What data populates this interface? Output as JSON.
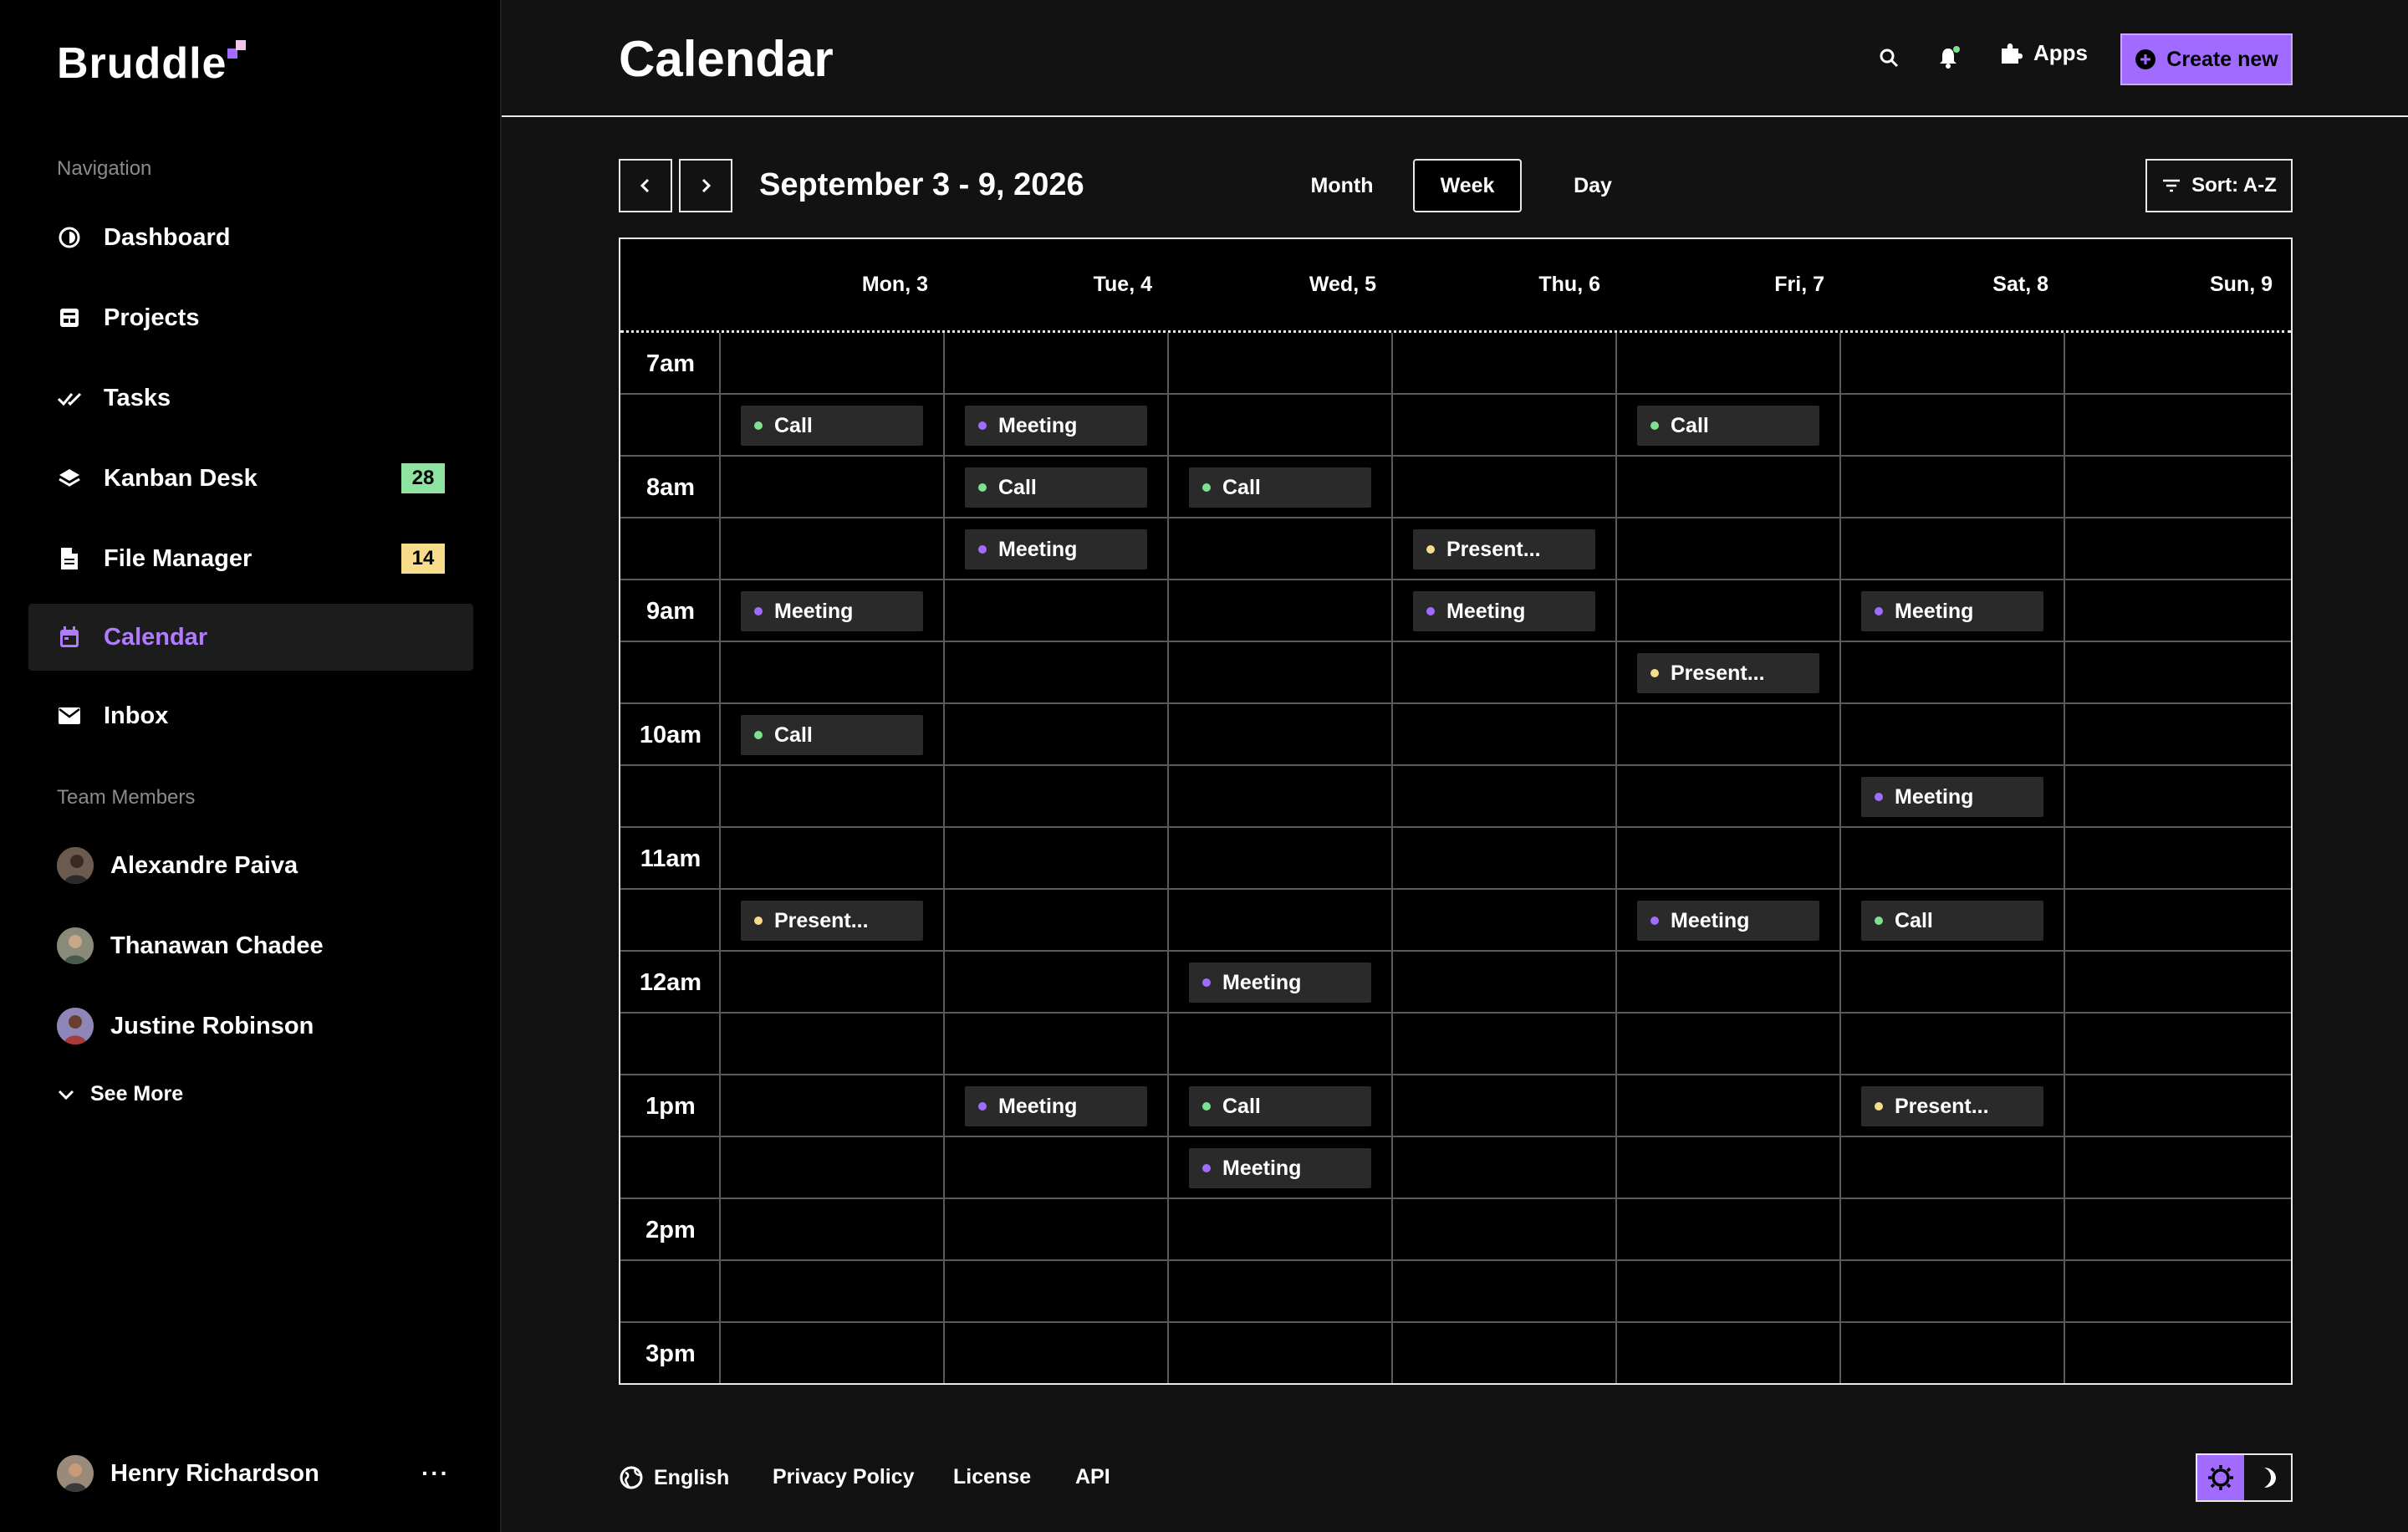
{
  "brand": {
    "name": "Bruddle"
  },
  "sidebar": {
    "nav_label": "Navigation",
    "items": [
      {
        "label": "Dashboard",
        "icon": "dashboard-icon"
      },
      {
        "label": "Projects",
        "icon": "projects-icon"
      },
      {
        "label": "Tasks",
        "icon": "tasks-icon"
      },
      {
        "label": "Kanban Desk",
        "icon": "layers-icon",
        "badge": "28",
        "badge_color": "#8fe3a0"
      },
      {
        "label": "File Manager",
        "icon": "file-icon",
        "badge": "14",
        "badge_color": "#f7dc8c"
      },
      {
        "label": "Calendar",
        "icon": "calendar-icon",
        "active": true
      },
      {
        "label": "Inbox",
        "icon": "mail-icon"
      }
    ],
    "team_label": "Team Members",
    "members": [
      {
        "name": "Alexandre Paiva"
      },
      {
        "name": "Thanawan Chadee"
      },
      {
        "name": "Justine Robinson"
      }
    ],
    "see_more": "See More",
    "user": {
      "name": "Henry Richardson",
      "menu": "···"
    }
  },
  "header": {
    "title": "Calendar",
    "apps_label": "Apps",
    "create_label": "Create new"
  },
  "toolbar": {
    "range": "September 3 - 9, 2026",
    "views": [
      "Month",
      "Week",
      "Day"
    ],
    "active_view": "Week",
    "sort_label": "Sort: A-Z"
  },
  "calendar": {
    "days": [
      "Mon, 3",
      "Tue, 4",
      "Wed, 5",
      "Thu, 6",
      "Fri, 7",
      "Sat, 8",
      "Sun, 9"
    ],
    "time_labels": [
      "7am",
      "",
      "8am",
      "",
      "9am",
      "",
      "10am",
      "",
      "11am",
      "",
      "12am",
      "",
      "1pm",
      "",
      "2pm",
      "",
      "3pm"
    ],
    "event_colors": {
      "Call": "#7fe08f",
      "Meeting": "#a26bff",
      "Present...": "#f7dc8c"
    },
    "events": [
      {
        "day": 0,
        "slot": 1,
        "label": "Call"
      },
      {
        "day": 1,
        "slot": 1,
        "label": "Meeting"
      },
      {
        "day": 4,
        "slot": 1,
        "label": "Call"
      },
      {
        "day": 1,
        "slot": 2,
        "label": "Call"
      },
      {
        "day": 2,
        "slot": 2,
        "label": "Call"
      },
      {
        "day": 1,
        "slot": 3,
        "label": "Meeting"
      },
      {
        "day": 3,
        "slot": 3,
        "label": "Present..."
      },
      {
        "day": 0,
        "slot": 4,
        "label": "Meeting"
      },
      {
        "day": 3,
        "slot": 4,
        "label": "Meeting"
      },
      {
        "day": 5,
        "slot": 4,
        "label": "Meeting"
      },
      {
        "day": 4,
        "slot": 5,
        "label": "Present..."
      },
      {
        "day": 0,
        "slot": 6,
        "label": "Call"
      },
      {
        "day": 5,
        "slot": 7,
        "label": "Meeting"
      },
      {
        "day": 0,
        "slot": 9,
        "label": "Present..."
      },
      {
        "day": 4,
        "slot": 9,
        "label": "Meeting"
      },
      {
        "day": 5,
        "slot": 9,
        "label": "Call"
      },
      {
        "day": 2,
        "slot": 10,
        "label": "Meeting"
      },
      {
        "day": 1,
        "slot": 12,
        "label": "Meeting"
      },
      {
        "day": 2,
        "slot": 12,
        "label": "Call"
      },
      {
        "day": 5,
        "slot": 12,
        "label": "Present..."
      },
      {
        "day": 2,
        "slot": 13,
        "label": "Meeting"
      }
    ]
  },
  "footer": {
    "links": [
      "English",
      "Privacy Policy",
      "License",
      "API"
    ]
  },
  "colors": {
    "accent": "#a26bff",
    "background": "#121212",
    "sidebar": "#000000"
  }
}
